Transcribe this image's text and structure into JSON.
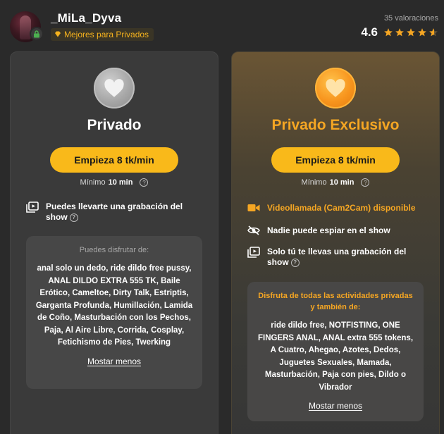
{
  "header": {
    "username": "_MiLa_Dyva",
    "badge": "Mejores para Privados",
    "reviews": "35 valoraciones",
    "rating": "4.6",
    "stars_filled_fraction": 0.92,
    "star_color": "#f5a623"
  },
  "private": {
    "title": "Privado",
    "button": "Empieza 8 tk/min",
    "min_label": "Mínimo",
    "min_value": "10 min",
    "features": [
      {
        "icon": "recording-icon",
        "text": "Puedes llevarte una grabación del show"
      }
    ],
    "activities_header": "Puedes disfrutar de:",
    "activities": "anal solo un dedo, ride dildo free pussy, ANAL DILDO EXTRA 555 TK, Baile Erótico, Cameltoe, Dirty Talk, Estriptis, Garganta Profunda, Humillación, Lamida de Coño, Masturbación con los Pechos, Paja, Al Aire Libre, Corrida, Cosplay, Fetichismo de Pies, Twerking",
    "show_less": "Mostar menos"
  },
  "exclusive": {
    "title": "Privado Exclusivo",
    "button": "Empieza 8 tk/min",
    "min_label": "Mínimo",
    "min_value": "10 min",
    "features": [
      {
        "icon": "video-camera-icon",
        "text": "Videollamada (Cam2Cam) disponible"
      },
      {
        "icon": "eye-slash-icon",
        "text": "Nadie puede espiar en el show"
      },
      {
        "icon": "recording-icon",
        "text": "Solo tú te llevas una grabación del show"
      }
    ],
    "activities_header": "Disfruta de todas las actividades privadas y también de:",
    "activities": "ride dildo free, NOTFISTING, ONE FINGERS ANAL, ANAL extra 555 tokens, A Cuatro, Ahegao, Azotes, Dedos, Juguetes Sexuales, Mamada, Masturbación, Paja con pies, Dildo o Vibrador",
    "show_less": "Mostar menos"
  },
  "colors": {
    "accent": "#f9b91a",
    "orange_text": "#f5a623",
    "background": "#2a2a2a"
  }
}
